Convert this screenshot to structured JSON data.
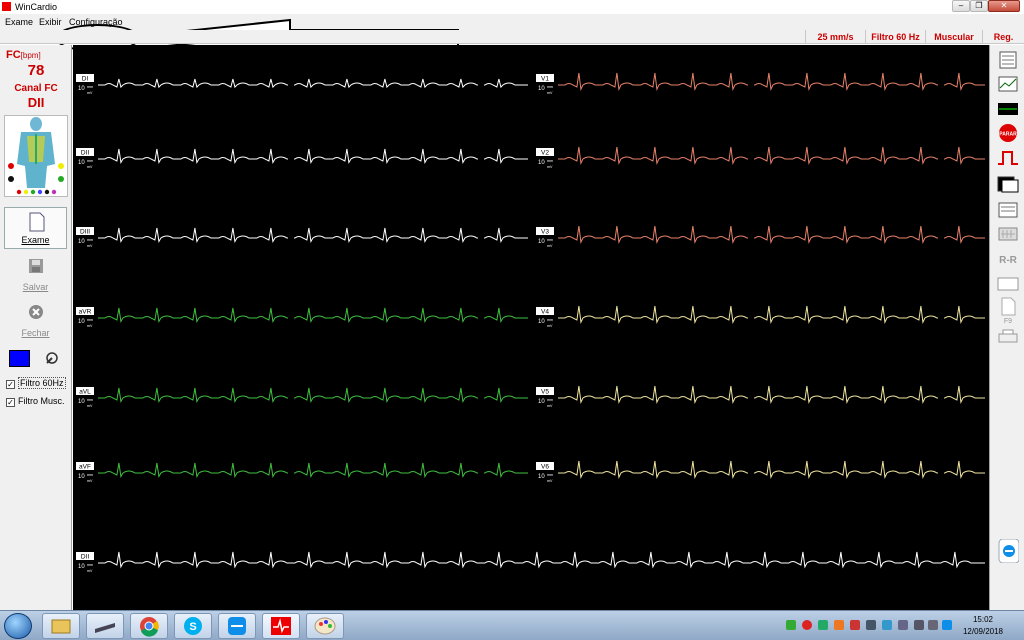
{
  "window": {
    "title": "WinCardio"
  },
  "menu": {
    "items": [
      "Exame",
      "Exibir",
      "Configuração"
    ]
  },
  "status": {
    "speed": "25 mm/s",
    "filter": "Filtro 60 Hz",
    "muscular": "Muscular",
    "reg": "Reg."
  },
  "left_panel": {
    "fc_label": "FC",
    "fc_unit": "[bpm]",
    "fc_value": "78",
    "canal_label": "Canal FC",
    "canal_value": "DII",
    "exame_label": "Exame",
    "salvar_label": "Salvar",
    "fechar_label": "Fechar",
    "filtro60_label": "Filtro 60Hz",
    "filtro60_checked": true,
    "filtromusc_label": "Filtro Musc.",
    "filtromusc_checked": true,
    "color_swatch": "#0000ff"
  },
  "leads": {
    "left": [
      {
        "name": "DI",
        "color": "#ffffff"
      },
      {
        "name": "DII",
        "color": "#ffffff"
      },
      {
        "name": "DIII",
        "color": "#ffffff"
      },
      {
        "name": "aVR",
        "color": "#3fbf3f"
      },
      {
        "name": "aVL",
        "color": "#3fbf3f"
      },
      {
        "name": "aVF",
        "color": "#3fbf3f"
      }
    ],
    "right": [
      {
        "name": "V1",
        "color": "#e8826a"
      },
      {
        "name": "V2",
        "color": "#e8826a"
      },
      {
        "name": "V3",
        "color": "#e8826a"
      },
      {
        "name": "V4",
        "color": "#f0e6a0"
      },
      {
        "name": "V5",
        "color": "#f0e6a0"
      },
      {
        "name": "V6",
        "color": "#f0e6a0"
      }
    ],
    "rhythm": {
      "name": "DII",
      "color": "#ffffff"
    },
    "gain_value": "10",
    "gain_unit_top": "mm",
    "gain_unit_bottom": "mV"
  },
  "right_toolbar": {
    "icons": [
      "report-icon",
      "chart-icon",
      "monitor-icon",
      "stop-icon",
      "pulse-icon",
      "window-icon",
      "list-icon",
      "grid-icon",
      "rr-icon",
      "blank-icon",
      "page-icon",
      "print-icon"
    ],
    "stop_label": "PARAR",
    "rr_label": "R-R",
    "f9_label": "F9"
  },
  "taskbar": {
    "apps": [
      "explorer-icon",
      "scanner-icon",
      "chrome-icon",
      "skype-icon",
      "teamviewer-icon",
      "wincardio-icon",
      "paint-icon"
    ],
    "time": "15:02",
    "date": "12/09/2018"
  }
}
